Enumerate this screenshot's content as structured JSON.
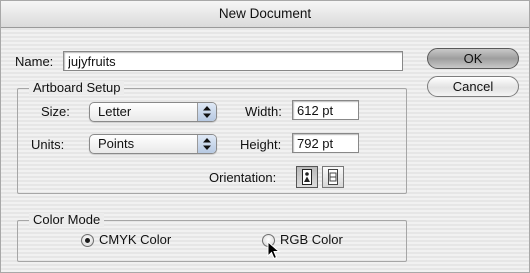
{
  "window": {
    "title": "New Document"
  },
  "name_field": {
    "label": "Name:",
    "value": "jujyfruits"
  },
  "buttons": {
    "ok": "OK",
    "cancel": "Cancel"
  },
  "artboard": {
    "title": "Artboard Setup",
    "size_label": "Size:",
    "size_value": "Letter",
    "units_label": "Units:",
    "units_value": "Points",
    "width_label": "Width:",
    "width_value": "612 pt",
    "height_label": "Height:",
    "height_value": "792 pt",
    "orientation_label": "Orientation:",
    "orientation_selected": "portrait"
  },
  "color_mode": {
    "title": "Color Mode",
    "options": [
      "CMYK Color",
      "RGB Color"
    ],
    "selected": "CMYK Color"
  }
}
